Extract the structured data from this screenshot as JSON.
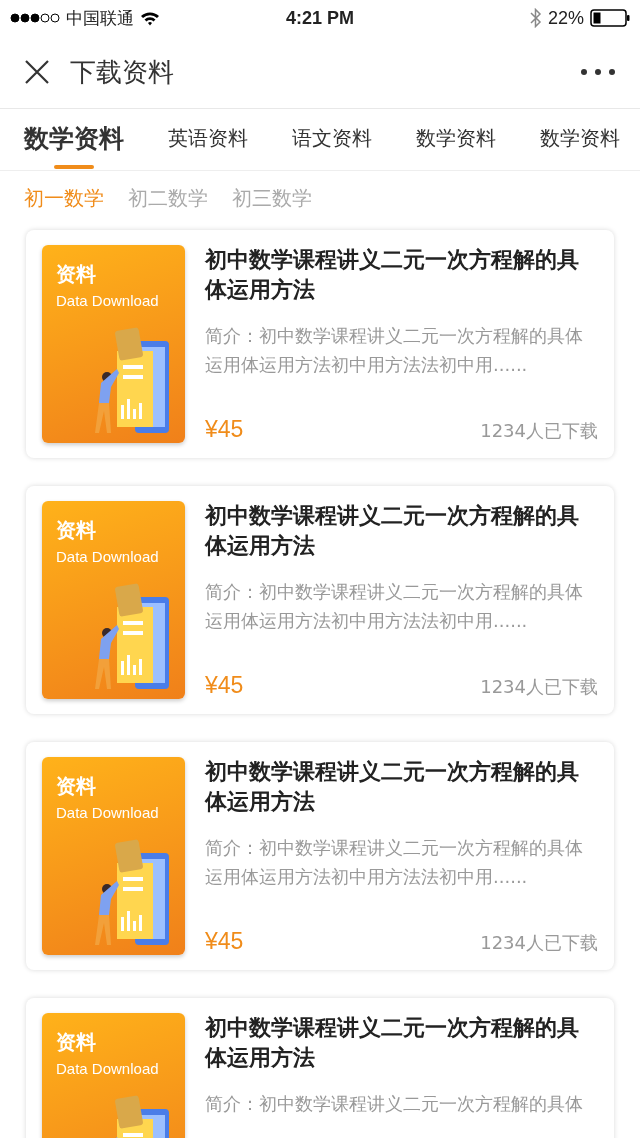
{
  "status_bar": {
    "carrier": "中国联通",
    "time": "4:21 PM",
    "battery": "22%"
  },
  "header": {
    "title": "下载资料"
  },
  "tabs": [
    {
      "label": "数学资料",
      "selected": true
    },
    {
      "label": "英语资料",
      "selected": false
    },
    {
      "label": "语文资料",
      "selected": false
    },
    {
      "label": "数学资料",
      "selected": false
    },
    {
      "label": "数学资料",
      "selected": false
    }
  ],
  "subtabs": [
    {
      "label": "初一数学",
      "selected": true
    },
    {
      "label": "初二数学",
      "selected": false
    },
    {
      "label": "初三数学",
      "selected": false
    }
  ],
  "items": [
    {
      "cover_title": "资料",
      "cover_subtitle": "Data Download",
      "title": "初中数学课程讲义二元一次方程解的具体运用方法",
      "summary": "简介：初中数学课程讲义二元一次方程解的具体运用体运用方法初中用方法法初中用......",
      "price": "¥45",
      "downloads": "1234人已下载"
    },
    {
      "cover_title": "资料",
      "cover_subtitle": "Data Download",
      "title": "初中数学课程讲义二元一次方程解的具体运用方法",
      "summary": "简介：初中数学课程讲义二元一次方程解的具体运用体运用方法初中用方法法初中用......",
      "price": "¥45",
      "downloads": "1234人已下载"
    },
    {
      "cover_title": "资料",
      "cover_subtitle": "Data Download",
      "title": "初中数学课程讲义二元一次方程解的具体运用方法",
      "summary": "简介：初中数学课程讲义二元一次方程解的具体运用体运用方法初中用方法法初中用......",
      "price": "¥45",
      "downloads": "1234人已下载"
    },
    {
      "cover_title": "资料",
      "cover_subtitle": "Data Download",
      "title": "初中数学课程讲义二元一次方程解的具体运用方法",
      "summary": "简介：初中数学课程讲义二元一次方程解的具体"
    }
  ]
}
